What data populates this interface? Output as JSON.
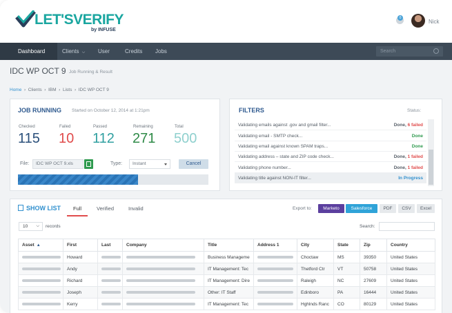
{
  "brand": {
    "name": "LET'SVERIFY",
    "sub": "by INFUSE",
    "color": "#1aa6a0"
  },
  "user": {
    "name": "Nick",
    "notifications": "0"
  },
  "nav": {
    "items": [
      "Dashboard",
      "Clients",
      "User",
      "Credits",
      "Jobs"
    ],
    "search_placeholder": "Search"
  },
  "page": {
    "title": "IDC WP OCT 9",
    "subtitle": "Job Running & Result"
  },
  "breadcrumb": [
    "Home",
    "Clients",
    "IBM",
    "Lists",
    "IDC WP OCT 9"
  ],
  "job": {
    "title": "JOB RUNNING",
    "started": "Started on October 12, 2014 at 1:21pm",
    "stats": [
      {
        "label": "Checked",
        "value": "115",
        "color": "#2a4f7a"
      },
      {
        "label": "Failed",
        "value": "10",
        "color": "#e04b4b"
      },
      {
        "label": "Passed",
        "value": "112",
        "color": "#2f9fa0"
      },
      {
        "label": "Remaining",
        "value": "271",
        "color": "#2e8a47"
      },
      {
        "label": "Total",
        "value": "500",
        "color": "#8fd0ce"
      }
    ],
    "file_label": "File:",
    "file_name": "IDC WP OCT 9.xls",
    "type_label": "Type:",
    "type_value": "Instant",
    "cancel_label": "Cancel",
    "progress": 0.63
  },
  "filters": {
    "title": "FILTERS",
    "status_label": "Status:",
    "rows": [
      {
        "text": "Validating emails against .gov and gmail filter...",
        "status": "Done, 6 failed",
        "failed": true
      },
      {
        "text": "Validating email - SMTP check...",
        "status": "Done",
        "failed": false
      },
      {
        "text": "Validating email against known SPAM traps...",
        "status": "Done",
        "failed": false
      },
      {
        "text": "Validating address – state and ZIP code check...",
        "status": "Done, 1 failed",
        "failed": true
      },
      {
        "text": "Validating phone number...",
        "status": "Done, 1 failed",
        "failed": true
      },
      {
        "text": "Validating title against NON-IT filter...",
        "status": "In Progress",
        "failed": false
      }
    ]
  },
  "list": {
    "title": "SHOW LIST",
    "tabs": [
      "Full",
      "Verified",
      "Invalid"
    ],
    "export_label": "Export to:",
    "exports": [
      {
        "label": "Marketo",
        "bg": "#5b3f9e",
        "fg": "#ffffff"
      },
      {
        "label": "Salesforce",
        "bg": "#2fa3d8",
        "fg": "#ffffff"
      },
      {
        "label": "PDF",
        "bg": "#e6e9ec",
        "fg": "#555d66"
      },
      {
        "label": "CSV",
        "bg": "#e6e9ec",
        "fg": "#555d66"
      },
      {
        "label": "Excel",
        "bg": "#e6e9ec",
        "fg": "#555d66"
      }
    ],
    "records_value": "10",
    "records_label": "records",
    "search_label": "Search:",
    "columns": [
      "Asset",
      "First",
      "Last",
      "Company",
      "Title",
      "Address 1",
      "City",
      "State",
      "Zip",
      "Country"
    ],
    "rows": [
      [
        "",
        "Howard",
        "",
        "",
        "Business Manageme",
        "",
        "Choctaw",
        "MS",
        "39350",
        "United States"
      ],
      [
        "",
        "Andy",
        "",
        "",
        "IT Management: Tec",
        "",
        "Thetford Ctr",
        "VT",
        "50758",
        "United States"
      ],
      [
        "",
        "Richard",
        "",
        "",
        "IT Management: Dire",
        "",
        "Raleigh",
        "NC",
        "27609",
        "United States"
      ],
      [
        "",
        "Joseph",
        "",
        "",
        "Other: IT Staff",
        "",
        "Edinboro",
        "PA",
        "16444",
        "United States"
      ],
      [
        "",
        "Kerry",
        "",
        "",
        "IT Management: Tec",
        "",
        "Hghlnds Ranc",
        "CO",
        "80129",
        "United States"
      ]
    ]
  }
}
